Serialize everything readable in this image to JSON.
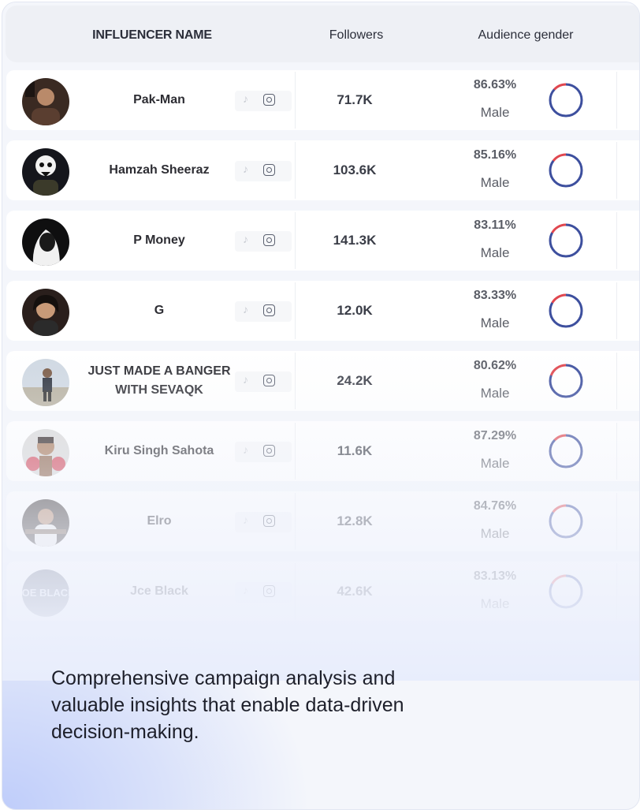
{
  "table": {
    "headers": {
      "name": "INFLUENCER NAME",
      "followers": "Followers",
      "gender": "Audience gender"
    },
    "rows": [
      {
        "name": "Pak-Man",
        "followers": "71.7K",
        "percent": "86.63%",
        "gender": "Male",
        "male_share": 0.8663
      },
      {
        "name": "Hamzah Sheeraz",
        "followers": "103.6K",
        "percent": "85.16%",
        "gender": "Male",
        "male_share": 0.8516
      },
      {
        "name": "P Money",
        "followers": "141.3K",
        "percent": "83.11%",
        "gender": "Male",
        "male_share": 0.8311
      },
      {
        "name": "G",
        "followers": "12.0K",
        "percent": "83.33%",
        "gender": "Male",
        "male_share": 0.8333
      },
      {
        "name": "JUST MADE A BANGER WITH SEVAQK",
        "followers": "24.2K",
        "percent": "80.62%",
        "gender": "Male",
        "male_share": 0.8062
      },
      {
        "name": "Kiru Singh Sahota",
        "followers": "11.6K",
        "percent": "87.29%",
        "gender": "Male",
        "male_share": 0.8729
      },
      {
        "name": "Elro",
        "followers": "12.8K",
        "percent": "84.76%",
        "gender": "Male",
        "male_share": 0.8476
      },
      {
        "name": "Jce Black",
        "followers": "42.6K",
        "percent": "83.13%",
        "gender": "Male",
        "male_share": 0.8313
      }
    ],
    "platform_icons": [
      "tiktok-icon",
      "instagram-icon"
    ],
    "avatar_logo_text": "JOE BLACK"
  },
  "caption": "Comprehensive campaign analysis and valuable insights that enable data-driven decision-making.",
  "colors": {
    "donut_male": "#3d4f9e",
    "donut_female": "#e0474f",
    "accent_gradient": "#bfcdfa"
  }
}
